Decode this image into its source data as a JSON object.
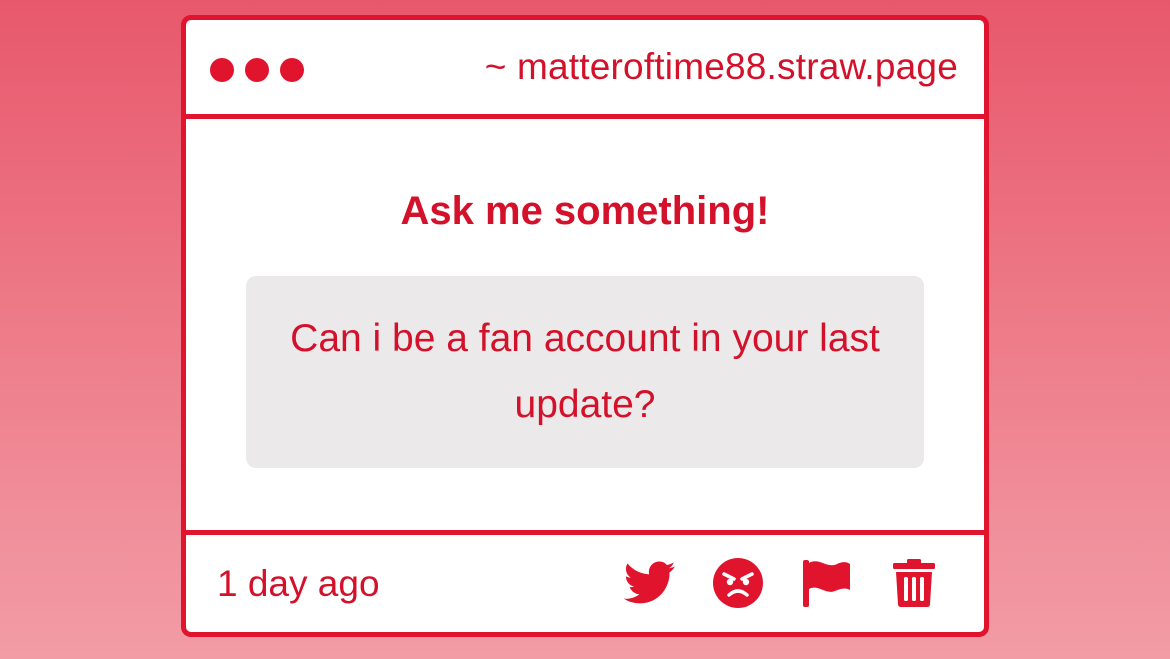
{
  "window": {
    "url": "~ matteroftime88.straw.page"
  },
  "main": {
    "heading": "Ask me something!",
    "question": "Can i be a fan account in your last update?"
  },
  "footer": {
    "timestamp": "1 day ago",
    "actions": [
      "twitter-icon",
      "angry-face-icon",
      "flag-icon",
      "trash-icon"
    ]
  },
  "colors": {
    "accent": "#e0142d",
    "question_background": "#ebe9ea",
    "page_background": "#ec6a7b"
  }
}
